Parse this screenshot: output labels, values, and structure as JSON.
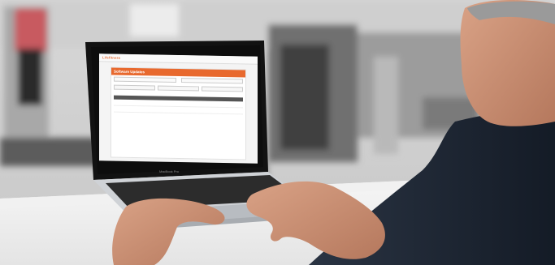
{
  "photo": {
    "description_icons": [
      "laptop-icon",
      "hands-icon",
      "gym-equipment-icon"
    ]
  },
  "laptop": {
    "brand_label": "MacBook Pro"
  },
  "screen": {
    "top_bar": {
      "logo_text": "Lifefitness",
      "nav_items": [
        "",
        "",
        "",
        ""
      ],
      "account_text": ""
    },
    "panel": {
      "title": "Software Updates",
      "header_button": "",
      "section_title": "",
      "section_subtitle": "",
      "table_headers": [
        "",
        "",
        ""
      ],
      "rows": [
        {
          "col1": "",
          "col2": "",
          "col3": ""
        },
        {
          "col1": "",
          "col2": "",
          "col3": ""
        }
      ]
    },
    "footer_text": ""
  },
  "colors": {
    "accent": "#e8692e",
    "laptop_body": "#c9ccd0",
    "screen_bezel": "#141414",
    "shirt": "#1f2835",
    "skin": "#c98f73"
  }
}
